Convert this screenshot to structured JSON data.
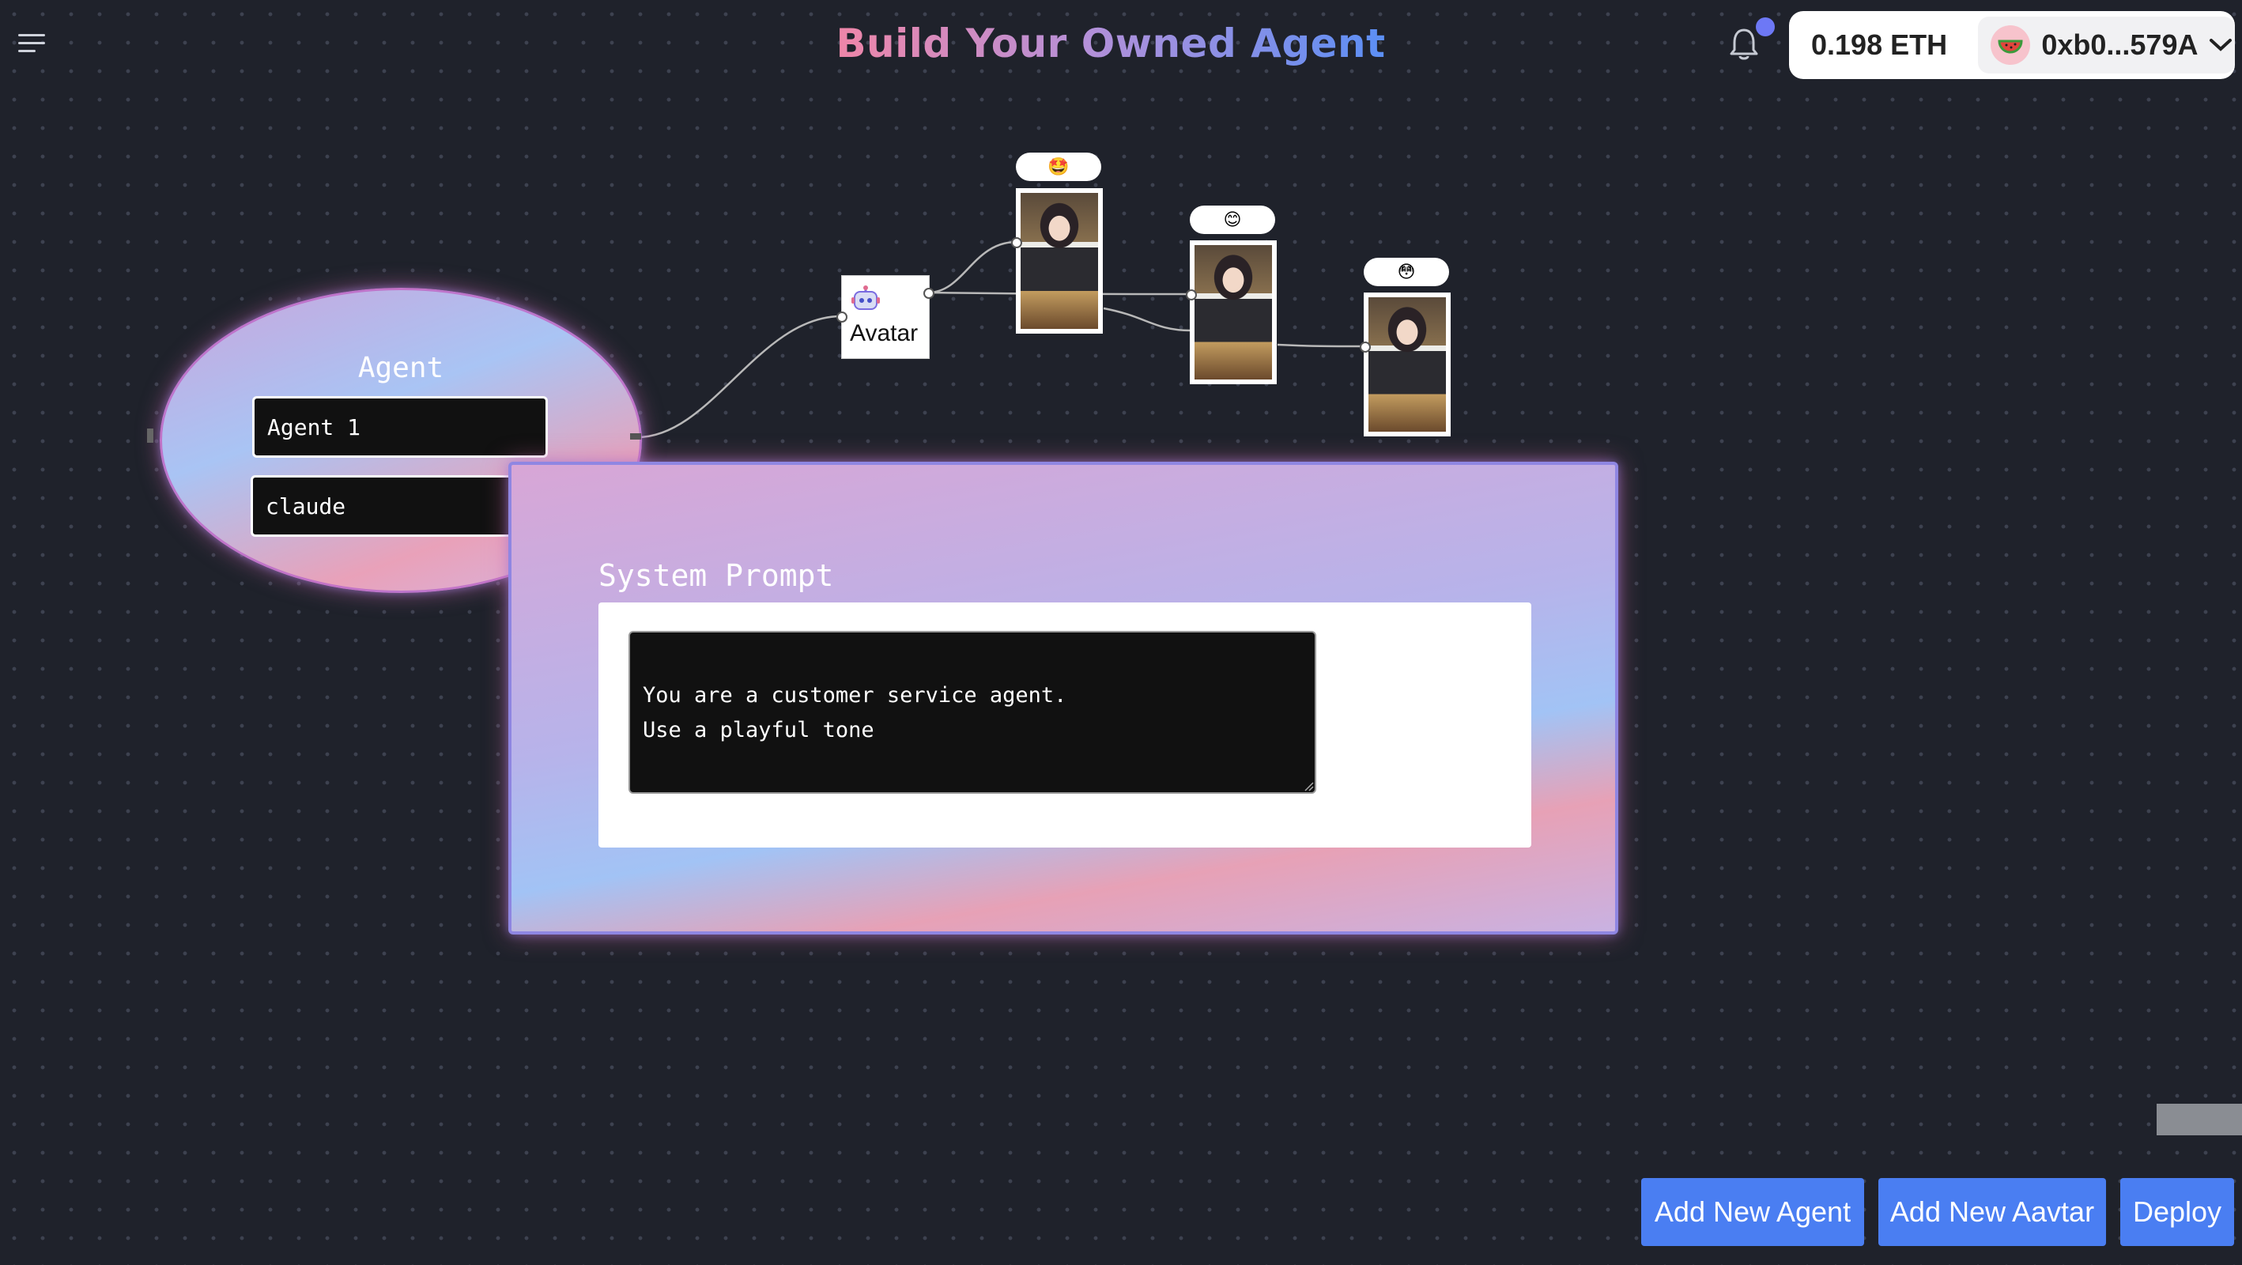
{
  "header": {
    "title": "Build Your Owned Agent",
    "menu_icon": "hamburger-menu-icon",
    "notification_icon": "bell-icon"
  },
  "wallet": {
    "balance": "0.198 ETH",
    "address": "0xb0...579A",
    "avatar_icon": "watermelon-icon",
    "dropdown_icon": "chevron-down-icon"
  },
  "agent_node": {
    "title": "Agent",
    "name_value": "Agent 1",
    "model_value": "claude"
  },
  "avatar_node": {
    "label": "Avatar",
    "icon": "robot-icon"
  },
  "expressions": [
    {
      "emoji": "🤩",
      "name": "star-struck"
    },
    {
      "emoji": "😊",
      "name": "smiling"
    },
    {
      "emoji": "😳",
      "name": "flushed"
    }
  ],
  "prompt_panel": {
    "title": "System Prompt",
    "value": "You are a customer service agent.\nUse a playful tone"
  },
  "actions": {
    "add_agent": "Add New Agent",
    "add_avatar": "Add New Aavtar",
    "deploy": "Deploy"
  },
  "colors": {
    "background": "#1f222b",
    "button": "#4a7ef2",
    "title_gradient_start": "#ef86a8",
    "title_gradient_end": "#5b8ff5"
  }
}
